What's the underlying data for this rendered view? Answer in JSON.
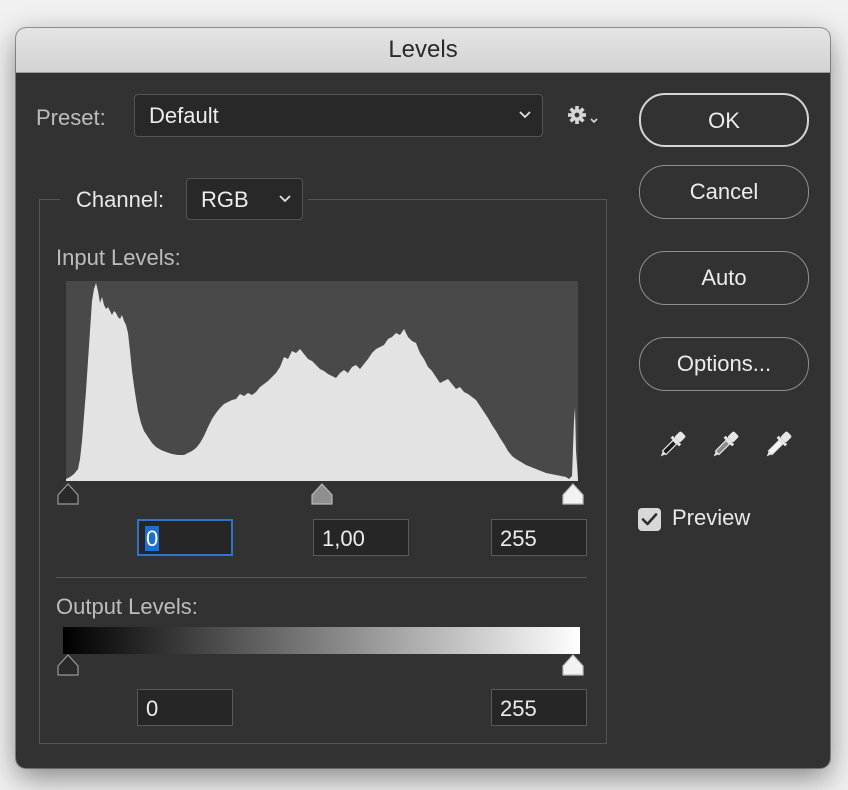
{
  "window": {
    "title": "Levels"
  },
  "preset": {
    "label": "Preset:",
    "value": "Default"
  },
  "channel": {
    "label": "Channel:",
    "value": "RGB"
  },
  "input_levels": {
    "label": "Input Levels:",
    "black": "0",
    "gamma": "1,00",
    "white": "255"
  },
  "output_levels": {
    "label": "Output Levels:",
    "black": "0",
    "white": "255"
  },
  "buttons": {
    "ok": "OK",
    "cancel": "Cancel",
    "auto": "Auto",
    "options": "Options..."
  },
  "preview": {
    "label": "Preview",
    "checked": true
  },
  "icons": {
    "settings": "gear-icon",
    "eyedroppers": [
      "black-point-eyedropper-icon",
      "gray-point-eyedropper-icon",
      "white-point-eyedropper-icon"
    ]
  }
}
